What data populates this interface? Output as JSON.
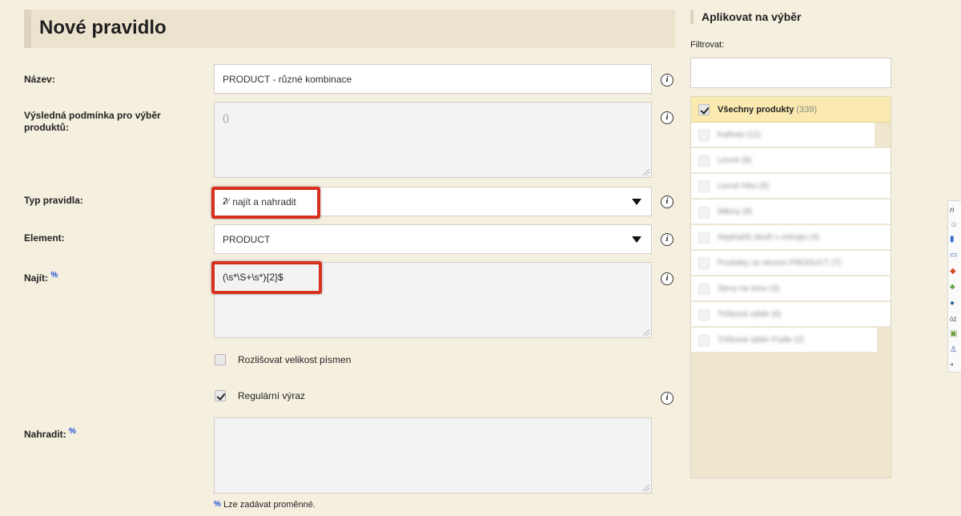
{
  "form": {
    "title": "Nové pravidlo",
    "name_label": "Název:",
    "name_value": "PRODUCT - různé kombinace",
    "condition_label": "Výsledná podmínka pro výběr produktů:",
    "condition_value": "()",
    "rule_type_label": "Typ pravidla:",
    "rule_type_value": "najít a nahradit",
    "element_label": "Element:",
    "element_value": "PRODUCT",
    "find_label": "Najít:",
    "find_value": "(\\s*\\S+\\s*){2}$",
    "case_label": "Rozlišovat velikost písmen",
    "case_checked": false,
    "regex_label": "Regulární výraz",
    "regex_checked": true,
    "replace_label": "Nahradit:",
    "replace_value": "",
    "percent_mark": "%",
    "variables_note": "Lze zadávat proměnné.",
    "info_glyph": "i",
    "highlight_color": "#d6301e"
  },
  "apply": {
    "title": "Aplikovat na výběr",
    "filter_label": "Filtrovat:",
    "filter_value": "",
    "all_label": "Všechny produkty",
    "all_count": "(339)",
    "all_checked": true,
    "items": [
      "Kalhoty (12)",
      "Levné (8)",
      "Levné triko (5)",
      "Mikiny (9)",
      "Nejdražší zboží v eshopu (4)",
      "Produkty se slovem PRODUCT (7)",
      "Slevy na zimu (3)",
      "Tričková výběr (6)",
      "Tričková výběr Podle (2)"
    ]
  }
}
